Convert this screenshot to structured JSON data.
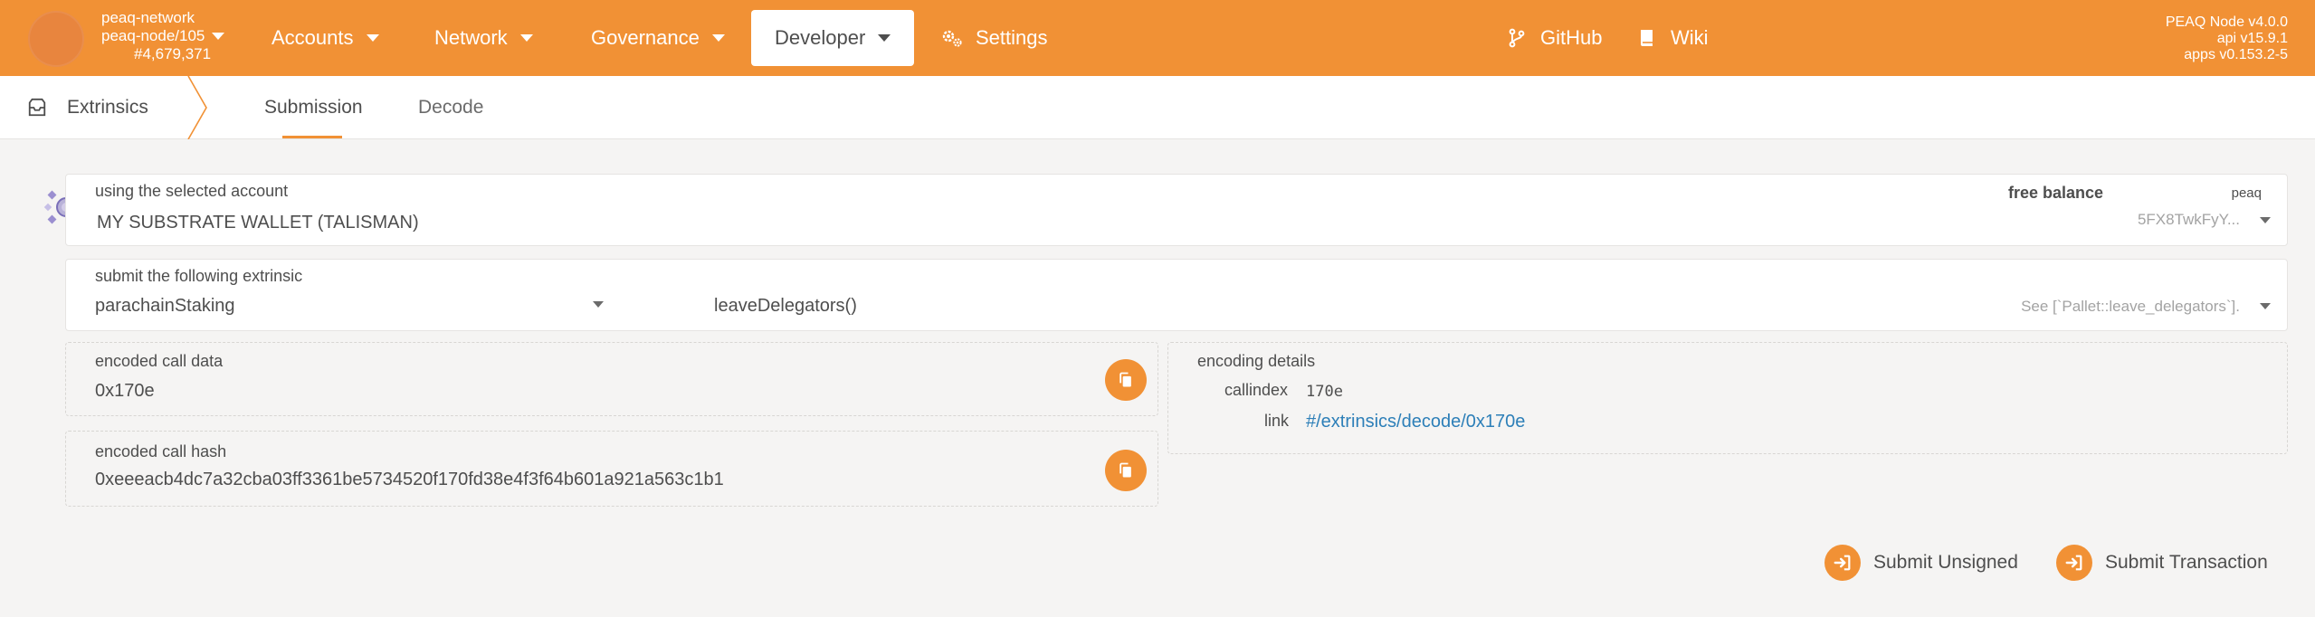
{
  "header": {
    "chain_name": "peaq-network",
    "node_name": "peaq-node/105",
    "block_number": "#4,679,371",
    "nav": [
      {
        "label": "Accounts"
      },
      {
        "label": "Network"
      },
      {
        "label": "Governance"
      },
      {
        "label": "Developer"
      },
      {
        "label": "Settings"
      }
    ],
    "github_label": "GitHub",
    "wiki_label": "Wiki",
    "version_node": "PEAQ Node v4.0.0",
    "version_api": "api v15.9.1",
    "version_apps": "apps v0.153.2-5",
    "brand_color": "#f19135"
  },
  "tabs": {
    "root_label": "Extrinsics",
    "items": [
      {
        "label": "Submission"
      },
      {
        "label": "Decode"
      }
    ]
  },
  "account": {
    "label": "using the selected account",
    "name": "MY SUBSTRATE WALLET (TALISMAN)",
    "balance_label": "free balance",
    "token": "peaq",
    "address": "5FX8TwkFyY..."
  },
  "extrinsic": {
    "label": "submit the following extrinsic",
    "pallet": "parachainStaking",
    "method": "leaveDelegators()",
    "doc": "See [`Pallet::leave_delegators`]."
  },
  "encoded_call_data": {
    "label": "encoded call data",
    "value": "0x170e"
  },
  "encoded_call_hash": {
    "label": "encoded call hash",
    "value": "0xeeeacb4dc7a32cba03ff3361be5734520f170fd38e4f3f64b601a921a563c1b1"
  },
  "encoding_details": {
    "label": "encoding details",
    "callindex_label": "callindex",
    "callindex_value": "170e",
    "link_label": "link",
    "link_value": "#/extrinsics/decode/0x170e"
  },
  "actions": {
    "submit_unsigned": "Submit Unsigned",
    "submit_transaction": "Submit Transaction"
  }
}
